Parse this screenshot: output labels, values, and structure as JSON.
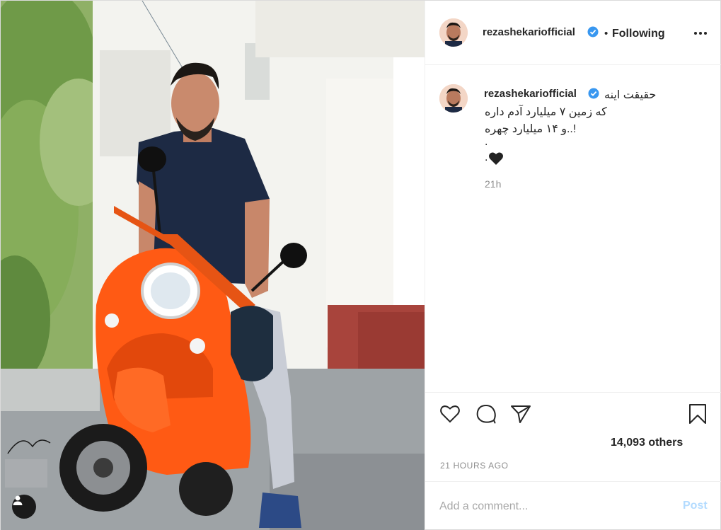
{
  "post": {
    "username": "rezashekariofficial",
    "follow_separator": "•",
    "follow_status": "Following",
    "caption": {
      "first_line": "حقیقت اینه",
      "second_line": "که زمین ۷ میلیارد آدم داره",
      "third_line": "!..و ۱۴ میلیارد چهره",
      "dot": ".",
      "dot2": ".",
      "emoji": "black-heart",
      "time": "21h"
    },
    "likes_text": "14,093 others",
    "posted_time": "21 HOURS AGO",
    "comment": {
      "placeholder": "Add a comment...",
      "post_label": "Post"
    },
    "photo": {
      "description_icons": [
        "person-tag-icon"
      ],
      "signature": "Reza"
    }
  },
  "colors": {
    "verified": "#3897f0",
    "scooter": "#ff5a14",
    "shirt": "#1d2a44",
    "wall": "#f2f2ef",
    "stairs": "#b9524a",
    "foliage": "#79a351",
    "muted_text": "#8e8e8e",
    "post_button_disabled": "#b3dbff"
  },
  "icons": {
    "more": "more-options-icon",
    "like": "heart-icon",
    "comment": "comment-icon",
    "share": "send-icon",
    "save": "bookmark-icon",
    "verified": "verified-badge-icon"
  }
}
